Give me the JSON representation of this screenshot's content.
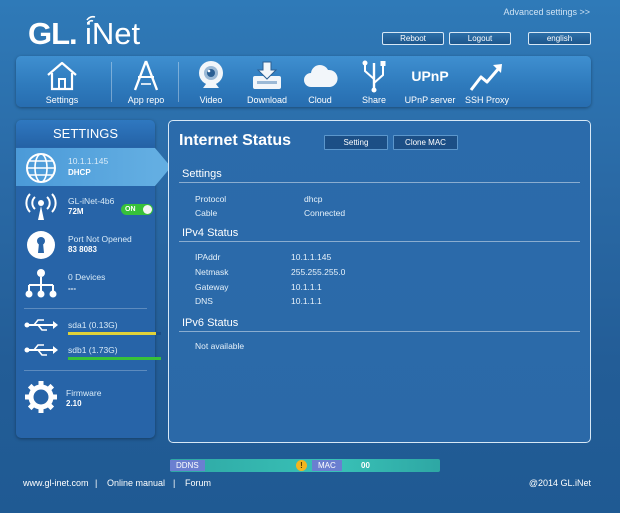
{
  "header": {
    "logo_text": "GL.iNet",
    "advanced_link": "Advanced settings >>",
    "buttons": {
      "reboot": "Reboot",
      "logout": "Logout",
      "language": "english"
    }
  },
  "nav": {
    "items": [
      {
        "label": "Settings",
        "icon": "house-icon"
      },
      {
        "label": "App repo",
        "icon": "app-repo-icon"
      },
      {
        "label": "Video",
        "icon": "webcam-icon"
      },
      {
        "label": "Download",
        "icon": "download-icon"
      },
      {
        "label": "Cloud",
        "icon": "cloud-icon"
      },
      {
        "label": "Share",
        "icon": "usb-share-icon"
      },
      {
        "label": "UPnP server",
        "icon": "upnp-icon"
      },
      {
        "label": "SSH Proxy",
        "icon": "ssh-proxy-icon"
      }
    ],
    "upnp_glyph_text": "UPnP"
  },
  "sidebar": {
    "title": "SETTINGS",
    "internet": {
      "line1": "10.1.1.145",
      "line2": "DHCP"
    },
    "wifi": {
      "line1": "GL-iNet-4b6",
      "line2": "72M",
      "toggle": "ON"
    },
    "port": {
      "line1": "Port Not Opened",
      "line2": "83 8083"
    },
    "clients": {
      "line1": "0 Devices",
      "line2": "---"
    },
    "storage": [
      {
        "label": "sda1 (0.13G)",
        "fill": 0.95,
        "color": "#e0d23a"
      },
      {
        "label": "sdb1 (1.73G)",
        "fill": 1.0,
        "color": "#37c13a"
      }
    ],
    "firmware": {
      "line1": "Firmware",
      "line2": "2.10"
    }
  },
  "main": {
    "title": "Internet Status",
    "buttons": {
      "setting": "Setting",
      "clone_mac": "Clone MAC"
    },
    "settings": {
      "heading": "Settings",
      "rows": [
        {
          "key": "Protocol",
          "value": "dhcp"
        },
        {
          "key": "Cable",
          "value": "Connected"
        }
      ]
    },
    "ipv4": {
      "heading": "IPv4 Status",
      "rows": [
        {
          "key": "IPAddr",
          "value": "10.1.1.145"
        },
        {
          "key": "Netmask",
          "value": "255.255.255.0"
        },
        {
          "key": "Gateway",
          "value": "10.1.1.1"
        },
        {
          "key": "DNS",
          "value": "10.1.1.1"
        }
      ]
    },
    "ipv6": {
      "heading": "IPv6 Status",
      "value": "Not available"
    }
  },
  "statusbar": {
    "ddns": "DDNS",
    "warn": "!",
    "mac": "MAC",
    "mac_value": "00"
  },
  "footer": {
    "site": "www.gl-inet.com",
    "sep1": "|",
    "manual": "Online manual",
    "sep2": "|",
    "forum": "Forum",
    "copyright": "@2014 GL.iNet"
  },
  "colors": {
    "accent": "#2f7bbd",
    "panel_border": "#d7e8f6",
    "toggle_on": "#37c13a",
    "ddns_tag": "#6a7fd0",
    "statusbar": "#39c2b7"
  }
}
